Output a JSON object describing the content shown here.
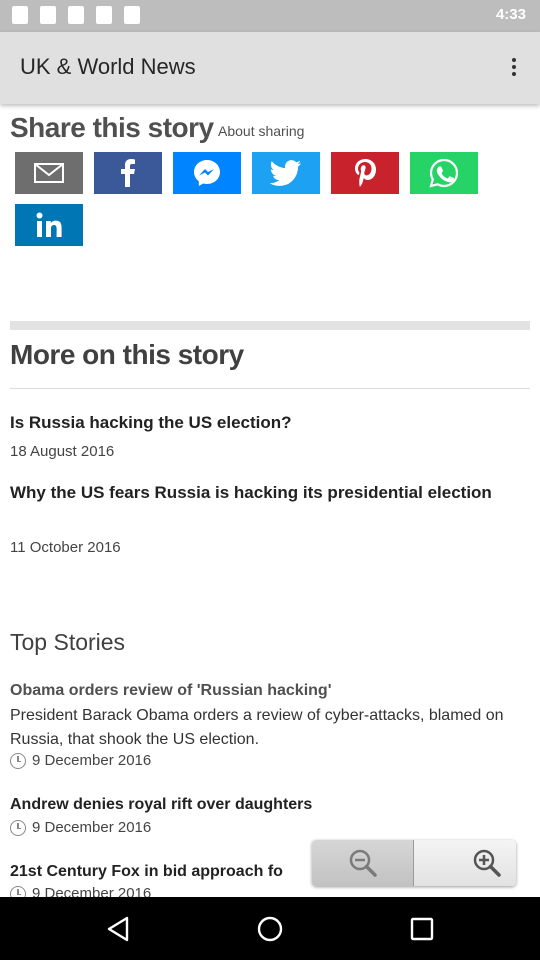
{
  "status_bar": {
    "time": "4:33"
  },
  "app_bar": {
    "title": "UK & World News"
  },
  "share": {
    "heading": "Share this story",
    "about_link": "About sharing",
    "buttons": [
      {
        "name": "email",
        "icon": "email-icon",
        "color": "#6e6e6e"
      },
      {
        "name": "facebook",
        "icon": "facebook-icon",
        "color": "#3b5998"
      },
      {
        "name": "messenger",
        "icon": "messenger-icon",
        "color": "#0084ff"
      },
      {
        "name": "twitter",
        "icon": "twitter-icon",
        "color": "#1da1f2"
      },
      {
        "name": "pinterest",
        "icon": "pinterest-icon",
        "color": "#c8232c"
      },
      {
        "name": "whatsapp",
        "icon": "whatsapp-icon",
        "color": "#25d366"
      },
      {
        "name": "linkedin",
        "icon": "linkedin-icon",
        "color": "#0077b5"
      }
    ]
  },
  "more_on_story": {
    "heading": "More on this story",
    "items": [
      {
        "title": "Is Russia hacking the US election?",
        "date": "18 August 2016"
      },
      {
        "title": "Why the US fears Russia is hacking its presidential election",
        "date": "11 October 2016"
      }
    ]
  },
  "top_stories": {
    "heading": "Top Stories",
    "items": [
      {
        "title": "Obama orders review of 'Russian hacking'",
        "summary": "President Barack Obama orders a review of cyber-attacks, blamed on Russia, that shook the US election.",
        "date": "9 December 2016"
      },
      {
        "title": "Andrew denies royal rift over daughters",
        "date": "9 December 2016"
      },
      {
        "title": "21st Century Fox in bid approach fo",
        "date": "9 December 2016"
      }
    ]
  },
  "zoom": {
    "out_icon": "zoom-out-icon",
    "in_icon": "zoom-in-icon"
  },
  "nav_bar": {
    "back_icon": "back-icon",
    "home_icon": "home-icon",
    "recents_icon": "recents-icon"
  }
}
